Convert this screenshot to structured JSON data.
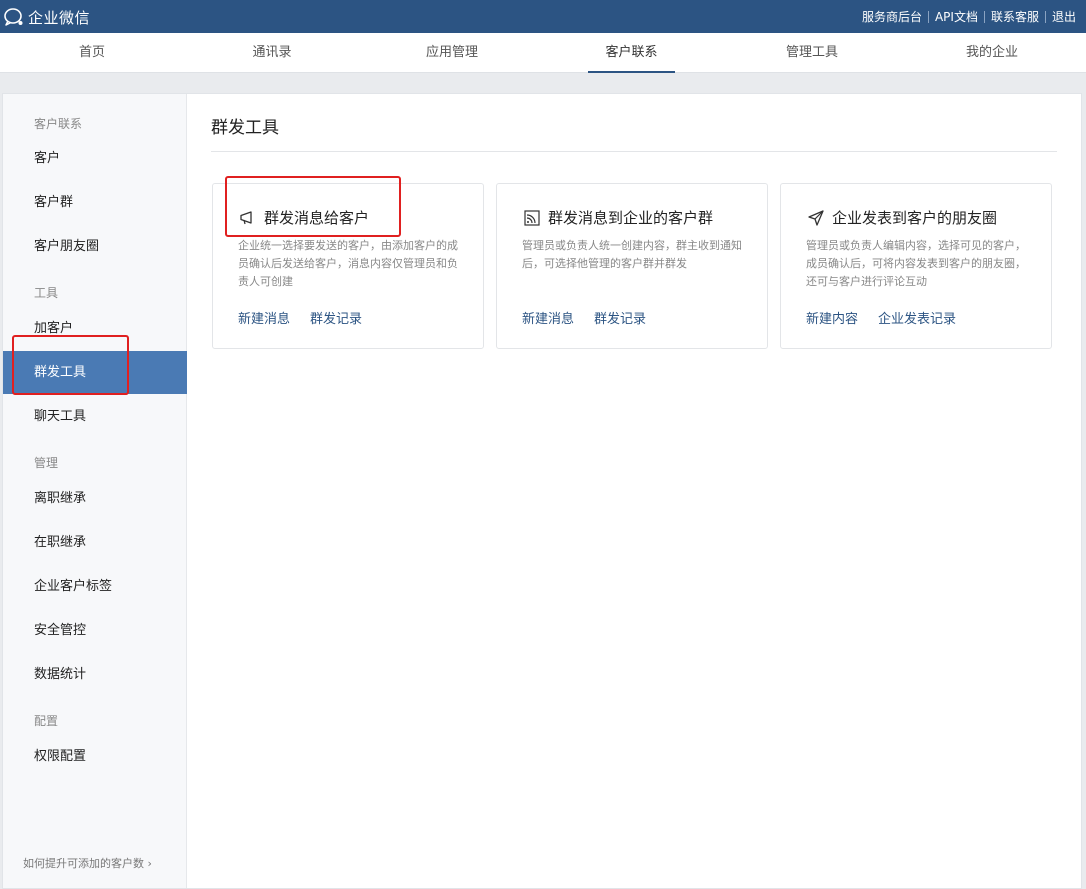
{
  "topbar": {
    "logo_text": "企业微信",
    "links": [
      "服务商后台",
      "API文档",
      "联系客服",
      "退出"
    ]
  },
  "nav": {
    "items": [
      "首页",
      "通讯录",
      "应用管理",
      "客户联系",
      "管理工具",
      "我的企业"
    ],
    "active": "客户联系"
  },
  "sidebar": {
    "groups": {
      "customer": "客户联系",
      "tools": "工具",
      "manage": "管理",
      "config": "配置"
    },
    "items": {
      "customer": "客户",
      "customer_group": "客户群",
      "moments": "客户朋友圈",
      "add_customer": "加客户",
      "mass_tool": "群发工具",
      "chat_tool": "聊天工具",
      "resign_inherit": "离职继承",
      "onjob_inherit": "在职继承",
      "tags": "企业客户标签",
      "security": "安全管控",
      "stats": "数据统计",
      "permissions": "权限配置"
    },
    "active": "群发工具",
    "footer": "如何提升可添加的客户数"
  },
  "main": {
    "title": "群发工具",
    "cards": [
      {
        "icon": "megaphone-icon",
        "title": "群发消息给客户",
        "desc": "企业统一选择要发送的客户，由添加客户的成员确认后发送给客户，消息内容仅管理员和负责人可创建",
        "links": [
          "新建消息",
          "群发记录"
        ]
      },
      {
        "icon": "broadcast-icon",
        "title": "群发消息到企业的客户群",
        "desc": "管理员或负责人统一创建内容，群主收到通知后，可选择他管理的客户群并群发",
        "links": [
          "新建消息",
          "群发记录"
        ]
      },
      {
        "icon": "paper-plane-icon",
        "title": "企业发表到客户的朋友圈",
        "desc": "管理员或负责人编辑内容，选择可见的客户，成员确认后，可将内容发表到客户的朋友圈，还可与客户进行评论互动",
        "links": [
          "新建内容",
          "企业发表记录"
        ]
      }
    ]
  },
  "colors": {
    "topbar": "#2c5483",
    "active_sidebar": "#4a7ab4",
    "link": "#2c5483",
    "annotation": "#e02020"
  }
}
